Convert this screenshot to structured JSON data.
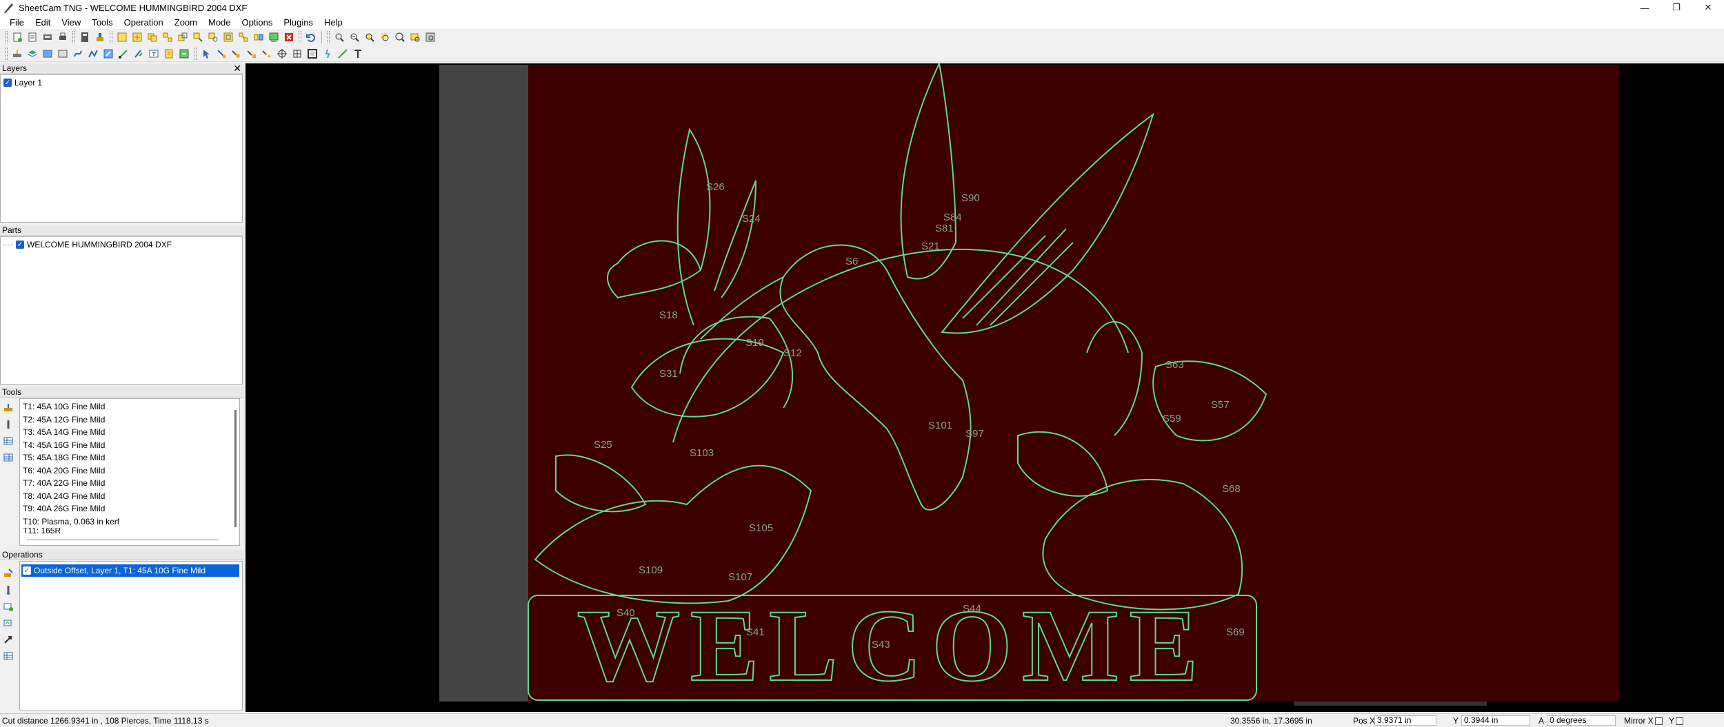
{
  "window": {
    "title": "SheetCam TNG - WELCOME HUMMINGBIRD 2004 DXF",
    "controls": [
      "—",
      "❐",
      "✕"
    ]
  },
  "menu": [
    "File",
    "Edit",
    "View",
    "Tools",
    "Operation",
    "Zoom",
    "Mode",
    "Options",
    "Plugins",
    "Help"
  ],
  "panels": {
    "layers": {
      "title": "Layers",
      "close": "✕",
      "items": [
        "Layer 1"
      ]
    },
    "parts": {
      "title": "Parts",
      "items": [
        "WELCOME HUMMINGBIRD 2004 DXF"
      ]
    },
    "tools": {
      "title": "Tools",
      "items": [
        "T1: 45A 10G Fine Mild",
        "T2: 45A 12G Fine Mild",
        "T3: 45A 14G Fine Mild",
        "T4: 45A 16G Fine Mild",
        "T5: 45A 18G Fine Mild",
        "T6: 40A 20G Fine Mild",
        "T7: 40A 22G Fine Mild",
        "T8: 40A 24G Fine Mild",
        "T9: 40A 26G Fine Mild",
        "T10: Plasma, 0.063 in kerf",
        "T11: 165R"
      ]
    },
    "operations": {
      "title": "Operations",
      "items": [
        "Outside Offset, Layer 1, T1: 45A 10G Fine Mild"
      ]
    }
  },
  "canvas": {
    "word": "WELCOME",
    "labels": [
      "S26",
      "S24",
      "S6",
      "S90",
      "S84",
      "S81",
      "S21",
      "S18",
      "S19",
      "S12",
      "S31",
      "S103",
      "S105",
      "S109",
      "S107",
      "S101",
      "S97",
      "S63",
      "S59",
      "S57",
      "S68",
      "S25",
      "S40",
      "S41",
      "S43",
      "S44",
      "S69"
    ],
    "colors": {
      "background": "#000000",
      "sheet": "#3d0000",
      "margin": "#444444",
      "outline": "#5fd98c"
    }
  },
  "status": {
    "cut_info": "Cut distance 1266.9341 in , 108 Pierces, Time 1118.13 s",
    "cursor": "30.3556 in, 17.3695 in",
    "pos_x_label": "Pos X",
    "pos_x": "3.9371 in",
    "y_label": "Y",
    "y": "0.3944 in",
    "a_label": "A",
    "a": "0 degrees",
    "mirror_x": "Mirror X",
    "mirror_y": "Y"
  }
}
